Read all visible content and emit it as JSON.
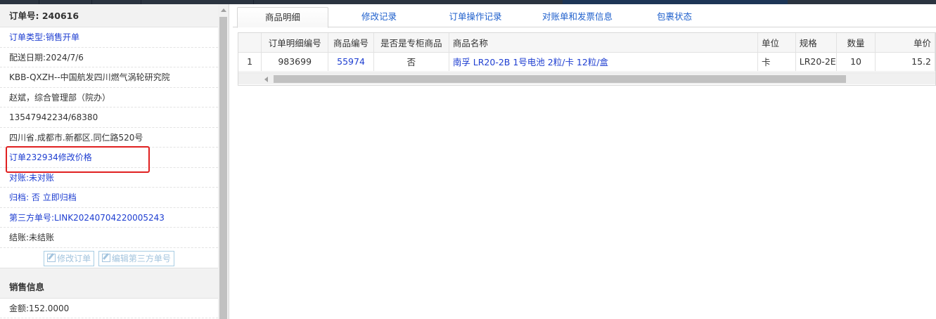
{
  "order": {
    "title_label": "订单号:",
    "title_value": "240616",
    "rows": [
      {
        "label": "订单类型:",
        "value": "销售开单"
      },
      {
        "label": "配送日期:",
        "value": "2024/7/6"
      },
      {
        "text": "KBB-QXZH--中国航发四川燃气涡轮研究院"
      },
      {
        "text": "赵斌，综合管理部（院办）"
      },
      {
        "text": "13547942234/68380"
      },
      {
        "text": "四川省.成都市.新都区.同仁路520号"
      },
      {
        "text": "订单232934修改价格"
      },
      {
        "label": "对账:",
        "value": "未对账"
      },
      {
        "label": "归档:",
        "value": "否 立即归档"
      },
      {
        "label": "第三方单号:",
        "value": "LINK20240704220005243"
      },
      {
        "label": "结账:",
        "value": "未结账"
      }
    ],
    "buttons": {
      "edit_order": "修改订单",
      "edit_third_party": "编辑第三方单号"
    }
  },
  "sales": {
    "title": "销售信息",
    "amount_label": "金额:",
    "amount_value": "152.0000"
  },
  "tabs": [
    "商品明细",
    "修改记录",
    "订单操作记录",
    "对账单和发票信息",
    "包裹状态"
  ],
  "active_tab": "商品明细",
  "table": {
    "headers": [
      "",
      "订单明细编号",
      "商品编号",
      "是否是专柜商品",
      "商品名称",
      "单位",
      "规格",
      "数量",
      "单价"
    ],
    "rows": [
      [
        "1",
        "983699",
        "55974",
        "否",
        "南孚 LR20-2B 1号电池 2粒/卡 12粒/盒",
        "卡",
        "LR20-2E",
        "10",
        "15.2"
      ]
    ]
  },
  "colors": {
    "link": "#1e3ed1",
    "highlight": "#e02020",
    "header_bg": "#f2f2f2"
  }
}
